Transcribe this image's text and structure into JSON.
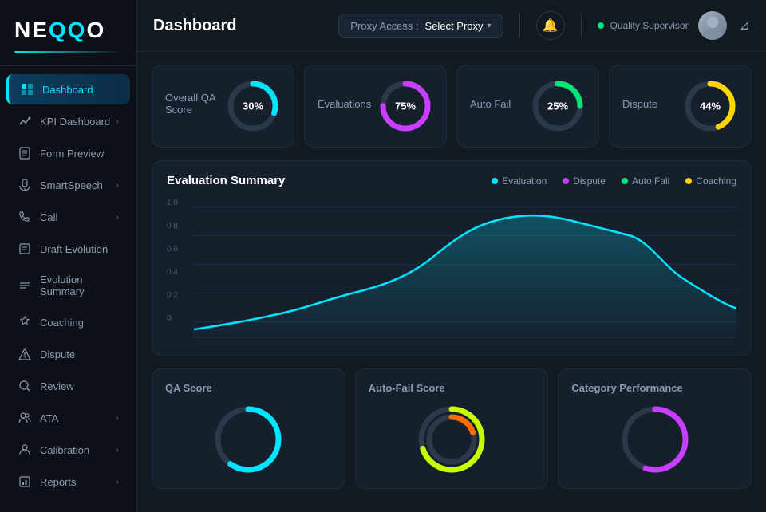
{
  "logo": {
    "text_main": "NEQQO",
    "accent_char": "QQ"
  },
  "sidebar": {
    "items": [
      {
        "id": "dashboard",
        "label": "Dashboard",
        "icon": "⊞",
        "active": true,
        "has_chevron": false
      },
      {
        "id": "kpi-dashboard",
        "label": "KPI Dashboard",
        "icon": "↗",
        "active": false,
        "has_chevron": true
      },
      {
        "id": "form-preview",
        "label": "Form Preview",
        "icon": "▤",
        "active": false,
        "has_chevron": false
      },
      {
        "id": "smartspeech",
        "label": "SmartSpeech",
        "icon": "🎤",
        "active": false,
        "has_chevron": true
      },
      {
        "id": "call",
        "label": "Call",
        "icon": "📞",
        "active": false,
        "has_chevron": true
      },
      {
        "id": "draft-evolution",
        "label": "Draft Evolution",
        "icon": "📋",
        "active": false,
        "has_chevron": false
      },
      {
        "id": "evolution-summary",
        "label": "Evolution Summary",
        "icon": "≡",
        "active": false,
        "has_chevron": false
      },
      {
        "id": "coaching",
        "label": "Coaching",
        "icon": "🛡",
        "active": false,
        "has_chevron": false
      },
      {
        "id": "dispute",
        "label": "Dispute",
        "icon": "🛡",
        "active": false,
        "has_chevron": false
      },
      {
        "id": "review",
        "label": "Review",
        "icon": "🔍",
        "active": false,
        "has_chevron": false
      },
      {
        "id": "ata",
        "label": "ATA",
        "icon": "👥",
        "active": false,
        "has_chevron": true
      },
      {
        "id": "calibration",
        "label": "Calibration",
        "icon": "👤",
        "active": false,
        "has_chevron": true
      },
      {
        "id": "reports",
        "label": "Reports",
        "icon": "📊",
        "active": false,
        "has_chevron": true
      }
    ]
  },
  "header": {
    "title": "Dashboard",
    "proxy_label": "Proxy Access :",
    "proxy_select": "Select Proxy",
    "user_status": "Quality Supervisor",
    "user_online": true,
    "filter_label": "filter"
  },
  "metric_cards": [
    {
      "title": "Overall QA Score",
      "value": 30,
      "label": "30%",
      "color": "#00e5ff",
      "track_color": "#2a3a4a",
      "id": "overall-qa"
    },
    {
      "title": "Evaluations",
      "value": 75,
      "label": "75%",
      "color": "#c83fff",
      "track_color": "#2a3a4a",
      "id": "evaluations"
    },
    {
      "title": "Auto Fail",
      "value": 25,
      "label": "25%",
      "color": "#00e676",
      "track_color": "#2a3a4a",
      "id": "auto-fail"
    },
    {
      "title": "Dispute",
      "value": 44,
      "label": "44%",
      "color": "#ffd600",
      "track_color": "#2a3a4a",
      "id": "dispute"
    }
  ],
  "eval_summary": {
    "title": "Evaluation Summary",
    "legend": [
      {
        "label": "Evaluation",
        "color": "#00e5ff"
      },
      {
        "label": "Dispute",
        "color": "#c83fff"
      },
      {
        "label": "Auto Fail",
        "color": "#00e676"
      },
      {
        "label": "Coaching",
        "color": "#ffd600"
      }
    ],
    "y_axis": [
      "1.0",
      "0.8",
      "0.6",
      "0.4",
      "0.2",
      "0"
    ],
    "chart_color": "#00e5ff"
  },
  "bottom_cards": [
    {
      "title": "QA Score",
      "id": "qa-score",
      "donuts": [
        {
          "value": 60,
          "color": "#00e5ff",
          "track": "#2a3a4a",
          "size": 90
        }
      ]
    },
    {
      "title": "Auto-Fail Score",
      "id": "auto-fail-score",
      "donuts": [
        {
          "value": 70,
          "color": "#c8ff00",
          "track": "#2a3a4a",
          "size": 90
        },
        {
          "value": 20,
          "color": "#ff6d00",
          "track": "transparent",
          "size": 70
        }
      ]
    },
    {
      "title": "Category Performance",
      "id": "category-performance",
      "donuts": [
        {
          "value": 55,
          "color": "#c83fff",
          "track": "#2a3a4a",
          "size": 90
        }
      ]
    }
  ],
  "colors": {
    "bg_dark": "#0d1117",
    "bg_card": "#161f2c",
    "bg_main": "#111921",
    "border": "#1e2d3d",
    "text_primary": "#ffffff",
    "text_secondary": "#8a9bb0",
    "accent_cyan": "#00e5ff",
    "accent_purple": "#c83fff",
    "accent_green": "#00e676",
    "accent_yellow": "#ffd600"
  }
}
